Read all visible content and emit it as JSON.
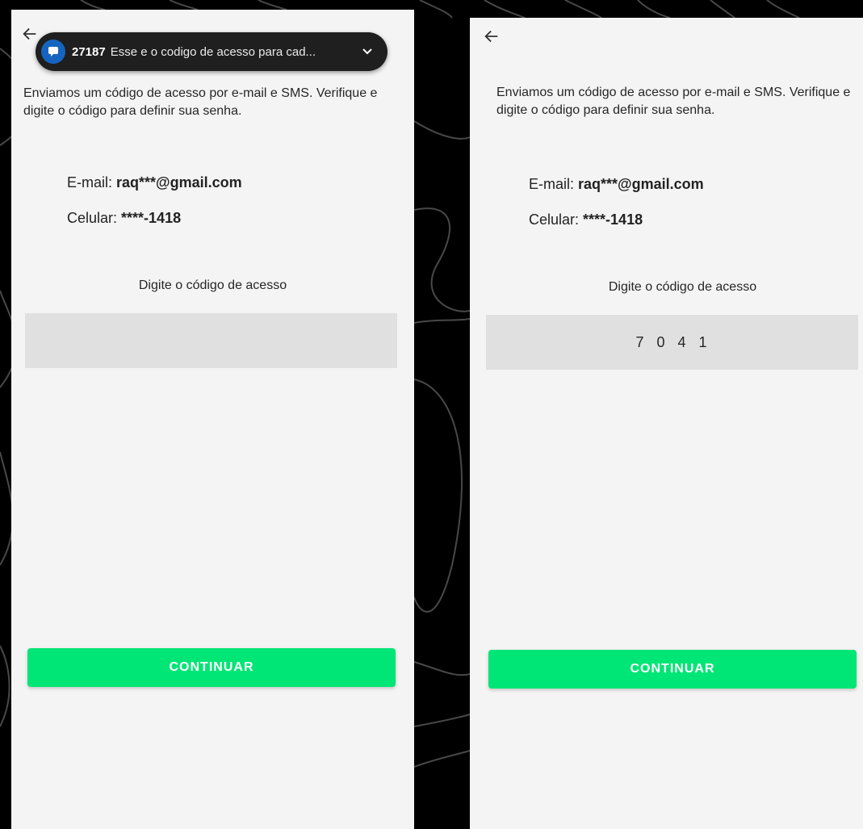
{
  "colors": {
    "background": "#000000",
    "screen": "#f4f4f4",
    "accent_button": "#00e676",
    "code_field": "#e0e0e0",
    "toast": "#1f1f1f",
    "toast_icon": "#1565c0"
  },
  "left_screen": {
    "back_icon": "arrow-left-icon",
    "notification": {
      "app_icon": "message-bubble-icon",
      "sender": "27187",
      "text": "Esse e o codigo de acesso para cad...",
      "expand_icon": "chevron-down-icon"
    },
    "instructions": "Enviamos um código de acesso por e-mail e SMS. Verifique e digite o código para definir sua senha.",
    "email_label": "E-mail: ",
    "email_value": "raq***@gmail.com",
    "phone_label": "Celular: ",
    "phone_value": "****-1418",
    "code_label": "Digite o código de acesso",
    "code_value": "",
    "continue_label": "CONTINUAR"
  },
  "right_screen": {
    "back_icon": "arrow-left-icon",
    "instructions": "Enviamos um código de acesso por e-mail e SMS. Verifique e digite o código para definir sua senha.",
    "email_label": "E-mail: ",
    "email_value": "raq***@gmail.com",
    "phone_label": "Celular: ",
    "phone_value": "****-1418",
    "code_label": "Digite o código de acesso",
    "code_value": "7041",
    "continue_label": "CONTINUAR"
  }
}
